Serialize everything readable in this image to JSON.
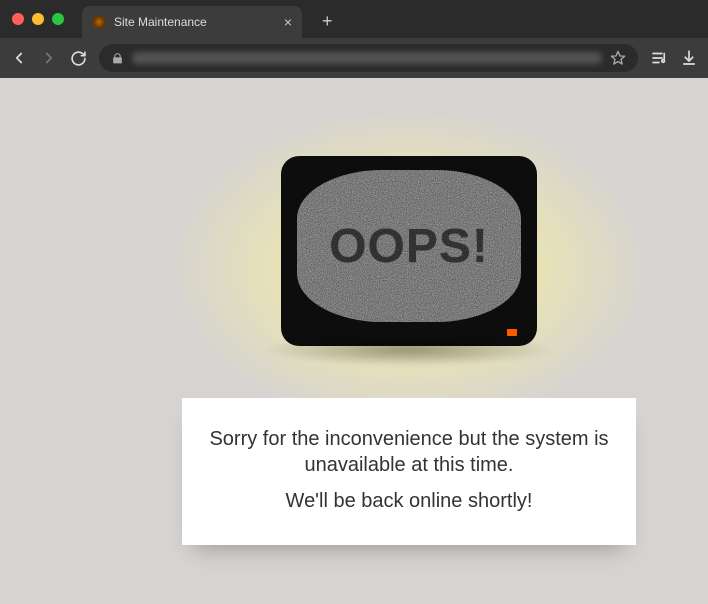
{
  "browser": {
    "tab_title": "Site Maintenance"
  },
  "page": {
    "oops": "OOPS!",
    "message_line1": "Sorry for the inconvenience but the system is unavailable at this time.",
    "message_line2": "We'll be back online shortly!"
  }
}
